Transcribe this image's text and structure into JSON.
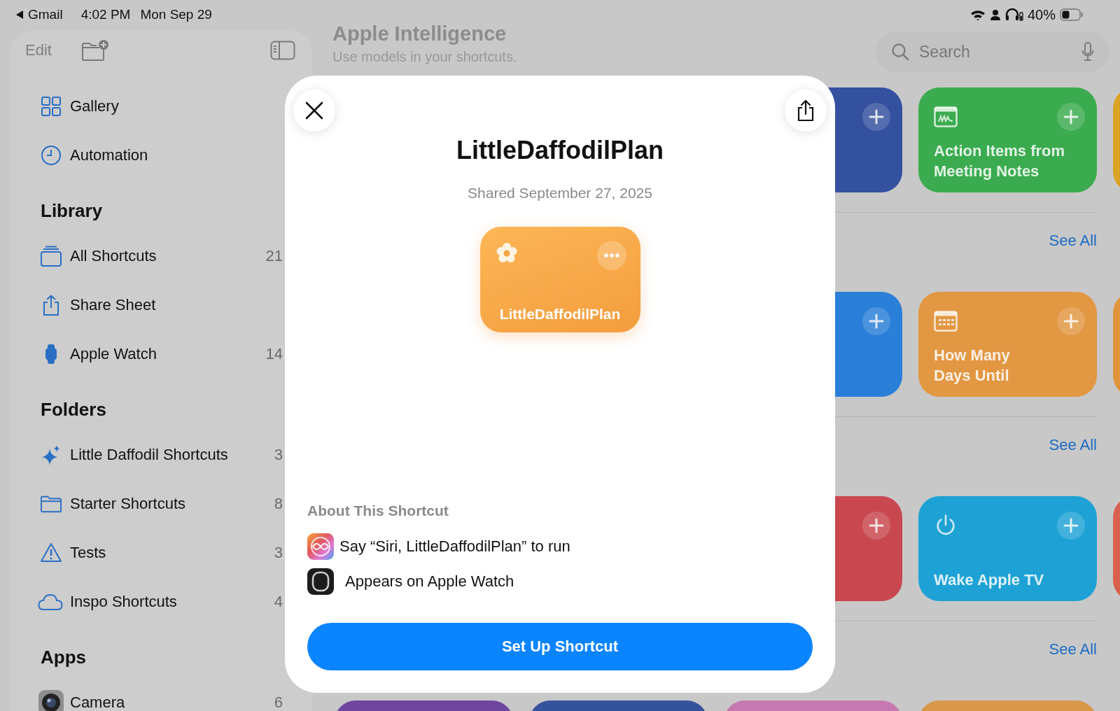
{
  "status_bar": {
    "back_app": "Gmail",
    "time": "4:02 PM",
    "date": "Mon Sep 29",
    "battery": "40%"
  },
  "sidebar": {
    "edit": "Edit",
    "top_items": [
      {
        "label": "Gallery",
        "kind": "gallery"
      },
      {
        "label": "Automation",
        "kind": "clock"
      }
    ],
    "sections": [
      {
        "title": "Library",
        "items": [
          {
            "label": "All Shortcuts",
            "kind": "stack",
            "count": "21"
          },
          {
            "label": "Share Sheet",
            "kind": "share"
          },
          {
            "label": "Apple Watch",
            "kind": "watch",
            "count": "14"
          }
        ]
      },
      {
        "title": "Folders",
        "items": [
          {
            "label": "Little Daffodil Shortcuts",
            "kind": "sparkle",
            "count": "3"
          },
          {
            "label": "Starter Shortcuts",
            "kind": "folder",
            "count": "8"
          },
          {
            "label": "Tests",
            "kind": "warning",
            "count": "3"
          },
          {
            "label": "Inspo Shortcuts",
            "kind": "cloud",
            "count": "4"
          }
        ]
      },
      {
        "title": "Apps",
        "items": [
          {
            "label": "Camera",
            "kind": "camera",
            "count": "6"
          }
        ]
      }
    ]
  },
  "header": {
    "title": "Apple Intelligence",
    "subtitle": "Use models in your shortcuts."
  },
  "search": {
    "placeholder": "Search"
  },
  "card_rows": [
    {
      "cards": [
        {
          "kind": "partial",
          "color": "#34519f"
        },
        {
          "kind": "note",
          "color": "#3bab4f",
          "label": "Action Items from\nMeeting Notes"
        },
        {
          "kind": "sliver",
          "color": "#dba323"
        }
      ]
    },
    {
      "see_all": "See All",
      "cards": [
        {
          "kind": "partial",
          "color": "#2a7fd8"
        },
        {
          "kind": "calendar",
          "color": "#e29742",
          "label": "How Many\nDays Until"
        },
        {
          "kind": "sliver",
          "color": "#e0953c"
        }
      ]
    },
    {
      "see_all": "See All",
      "cards": [
        {
          "kind": "partial",
          "color": "#c9474f"
        },
        {
          "kind": "power",
          "color": "#1ea2d6",
          "label": "Wake Apple TV"
        },
        {
          "kind": "sliver",
          "color": "#d9604e"
        }
      ]
    },
    {
      "see_all": "See All",
      "cards": [
        {
          "kind": "bottom",
          "color": "#6e46a0"
        },
        {
          "kind": "bottom",
          "color": "#35539d"
        },
        {
          "kind": "bottom",
          "color": "#c479b0"
        },
        {
          "kind": "bottom",
          "color": "#d9974a"
        }
      ]
    }
  ],
  "modal": {
    "title": "LittleDaffodilPlan",
    "shared": "Shared September 27, 2025",
    "tile": {
      "label": "LittleDaffodilPlan"
    },
    "about_heading": "About This Shortcut",
    "about": [
      {
        "kind": "siri",
        "text": "Say “Siri, LittleDaffodilPlan” to run"
      },
      {
        "kind": "watch",
        "text": "Appears on Apple Watch"
      }
    ],
    "button": "Set Up Shortcut"
  }
}
